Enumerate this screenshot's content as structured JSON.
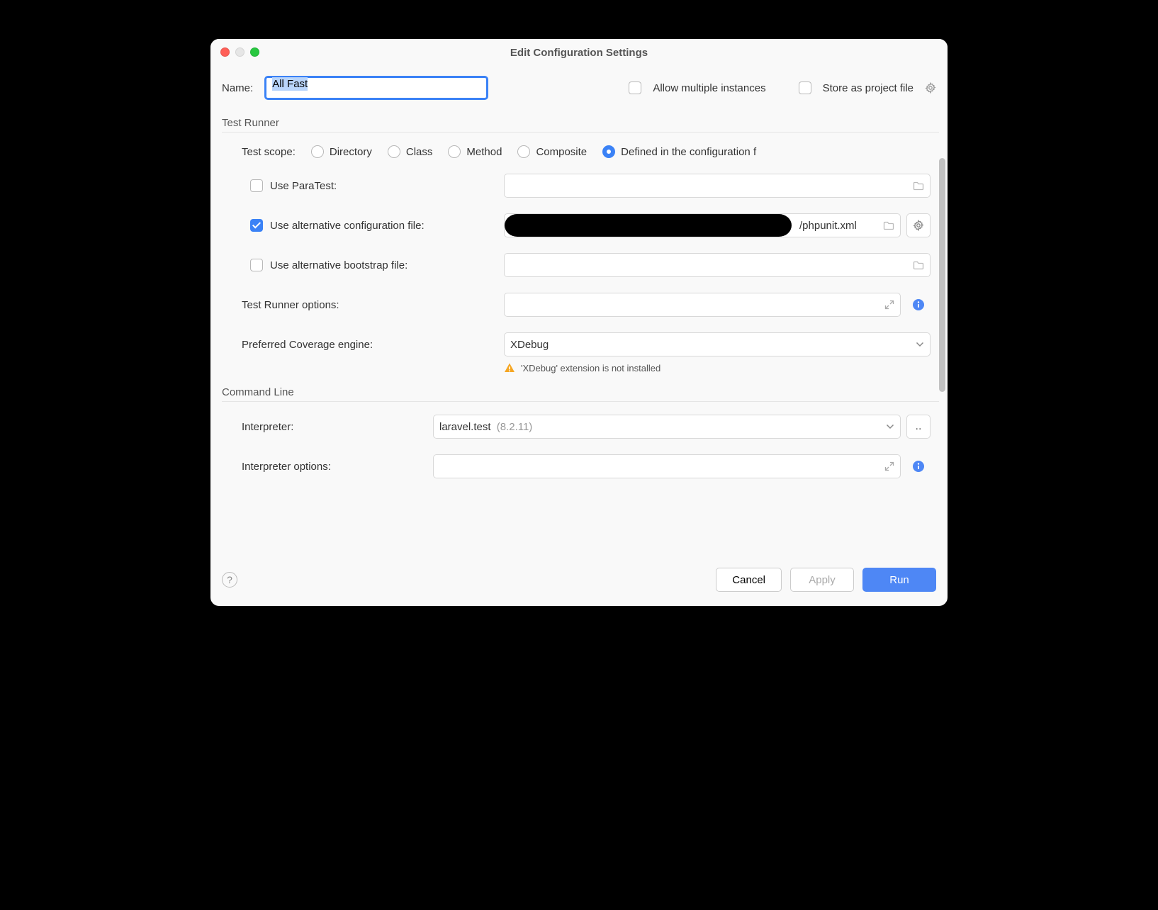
{
  "window": {
    "title": "Edit Configuration Settings"
  },
  "top": {
    "name_label": "Name:",
    "name_value": "All Fast",
    "allow_multiple_label": "Allow multiple instances",
    "store_project_label": "Store as project file"
  },
  "test_runner": {
    "section_title": "Test Runner",
    "scope_label": "Test scope:",
    "scope_options": {
      "directory": "Directory",
      "class": "Class",
      "method": "Method",
      "composite": "Composite",
      "defined": "Defined in the configuration f"
    },
    "paratest_label": "Use ParaTest:",
    "alt_config_label": "Use alternative configuration file:",
    "alt_config_value_suffix": "/phpunit.xml",
    "alt_bootstrap_label": "Use alternative bootstrap file:",
    "runner_options_label": "Test Runner options:",
    "coverage_label": "Preferred Coverage engine:",
    "coverage_value": "XDebug",
    "warning_text": "'XDebug' extension is not installed"
  },
  "command_line": {
    "section_title": "Command Line",
    "interpreter_label": "Interpreter:",
    "interpreter_value": "laravel.test",
    "interpreter_version": "(8.2.11)",
    "browse_label": "..",
    "interpreter_options_label": "Interpreter options:"
  },
  "footer": {
    "cancel": "Cancel",
    "apply": "Apply",
    "run": "Run"
  }
}
